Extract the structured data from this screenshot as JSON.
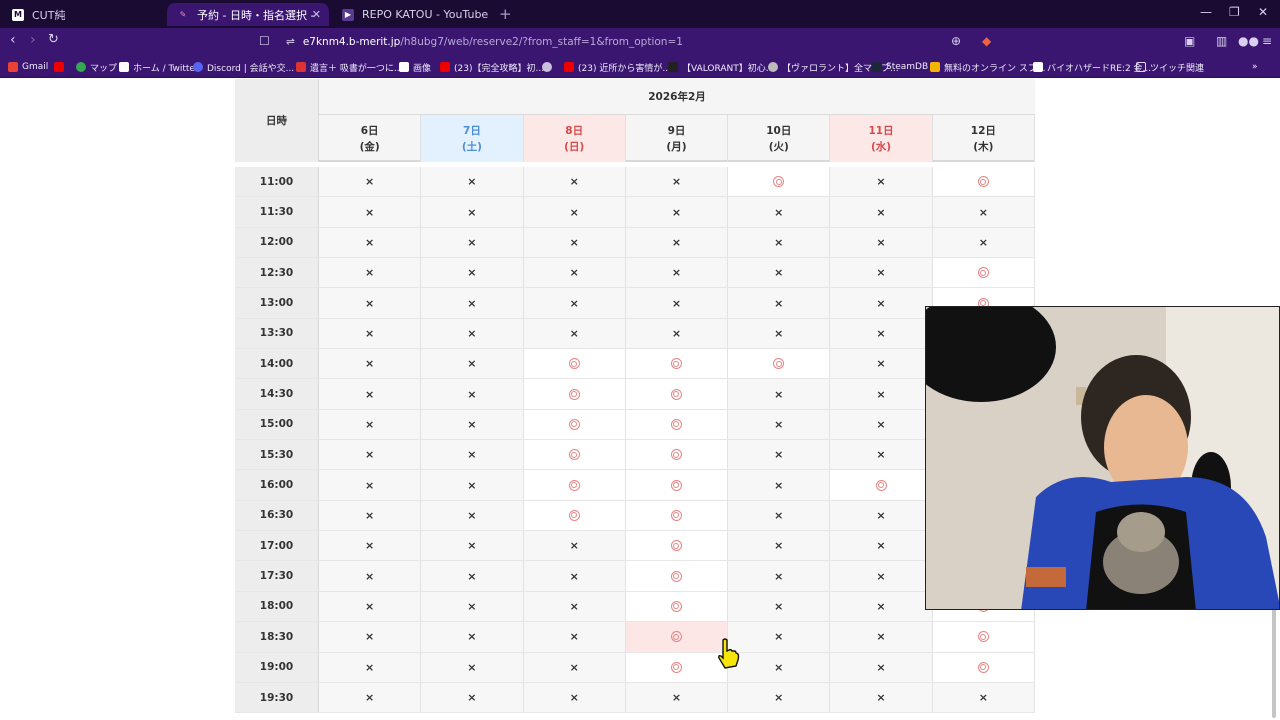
{
  "browser": {
    "tabs": [
      {
        "title": "CUT純",
        "icon": "scissors-tab-icon"
      },
      {
        "title": "予約 - 日時・指名選択 - CUT純ac",
        "icon": "reservation-tab-icon"
      },
      {
        "title": "REPO KATOU - YouTube",
        "icon": "youtube-tab-icon"
      }
    ],
    "url_host": "e7knm4.b-merit.jp",
    "url_path": "/h8ubg7/web/reserve2/?from_staff=1&from_option=1",
    "bookmarks": [
      "Gmail",
      "マップ",
      "ホーム / Twitter",
      "Discord | 会話や交...",
      "遺言＋ 吸書が一つに...",
      "画像",
      "(23)【完全攻略】初...",
      "(23) 近所から害情が...",
      "【VALORANT】初心...",
      "【ヴァロラント】全マップ...",
      "SteamDB",
      "無料のオンライン スプ...",
      "バイオハザードRE:2 金...",
      "ツイッチ関連"
    ],
    "colors": {
      "chrome_dark": "#1a0b33",
      "chrome": "#3a1670"
    }
  },
  "calendar": {
    "date_label": "日時",
    "month": "2026年2月",
    "days": [
      {
        "date": "6日",
        "dow": "(金)",
        "type": "weekday"
      },
      {
        "date": "7日",
        "dow": "(土)",
        "type": "sat"
      },
      {
        "date": "8日",
        "dow": "(日)",
        "type": "sun"
      },
      {
        "date": "9日",
        "dow": "(月)",
        "type": "weekday"
      },
      {
        "date": "10日",
        "dow": "(火)",
        "type": "weekday"
      },
      {
        "date": "11日",
        "dow": "(水)",
        "type": "sun"
      },
      {
        "date": "12日",
        "dow": "(木)",
        "type": "weekday"
      }
    ],
    "available_mark": "◎",
    "unavailable_mark": "×",
    "rows": [
      {
        "time": "11:00",
        "slots": [
          "×",
          "×",
          "×",
          "×",
          "◎",
          "×",
          "◎"
        ]
      },
      {
        "time": "11:30",
        "slots": [
          "×",
          "×",
          "×",
          "×",
          "×",
          "×",
          "×"
        ]
      },
      {
        "time": "12:00",
        "slots": [
          "×",
          "×",
          "×",
          "×",
          "×",
          "×",
          "×"
        ]
      },
      {
        "time": "12:30",
        "slots": [
          "×",
          "×",
          "×",
          "×",
          "×",
          "×",
          "◎"
        ]
      },
      {
        "time": "13:00",
        "slots": [
          "×",
          "×",
          "×",
          "×",
          "×",
          "×",
          "◎"
        ]
      },
      {
        "time": "13:30",
        "slots": [
          "×",
          "×",
          "×",
          "×",
          "×",
          "×",
          "◎"
        ]
      },
      {
        "time": "14:00",
        "slots": [
          "×",
          "×",
          "◎",
          "◎",
          "◎",
          "×",
          "◎"
        ]
      },
      {
        "time": "14:30",
        "slots": [
          "×",
          "×",
          "◎",
          "◎",
          "×",
          "×",
          "◎"
        ]
      },
      {
        "time": "15:00",
        "slots": [
          "×",
          "×",
          "◎",
          "◎",
          "×",
          "×",
          "◎"
        ]
      },
      {
        "time": "15:30",
        "slots": [
          "×",
          "×",
          "◎",
          "◎",
          "×",
          "×",
          "◎"
        ]
      },
      {
        "time": "16:00",
        "slots": [
          "×",
          "×",
          "◎",
          "◎",
          "×",
          "◎",
          "◎"
        ]
      },
      {
        "time": "16:30",
        "slots": [
          "×",
          "×",
          "◎",
          "◎",
          "×",
          "×",
          "◎"
        ]
      },
      {
        "time": "17:00",
        "slots": [
          "×",
          "×",
          "×",
          "◎",
          "×",
          "×",
          "◎"
        ]
      },
      {
        "time": "17:30",
        "slots": [
          "×",
          "×",
          "×",
          "◎",
          "×",
          "×",
          "◎"
        ]
      },
      {
        "time": "18:00",
        "slots": [
          "×",
          "×",
          "×",
          "◎",
          "×",
          "×",
          "◎"
        ]
      },
      {
        "time": "18:30",
        "slots": [
          "×",
          "×",
          "×",
          "◎",
          "×",
          "×",
          "◎"
        ]
      },
      {
        "time": "19:00",
        "slots": [
          "×",
          "×",
          "×",
          "◎",
          "×",
          "×",
          "◎"
        ]
      },
      {
        "time": "19:30",
        "slots": [
          "×",
          "×",
          "×",
          "×",
          "×",
          "×",
          "×"
        ]
      }
    ]
  }
}
